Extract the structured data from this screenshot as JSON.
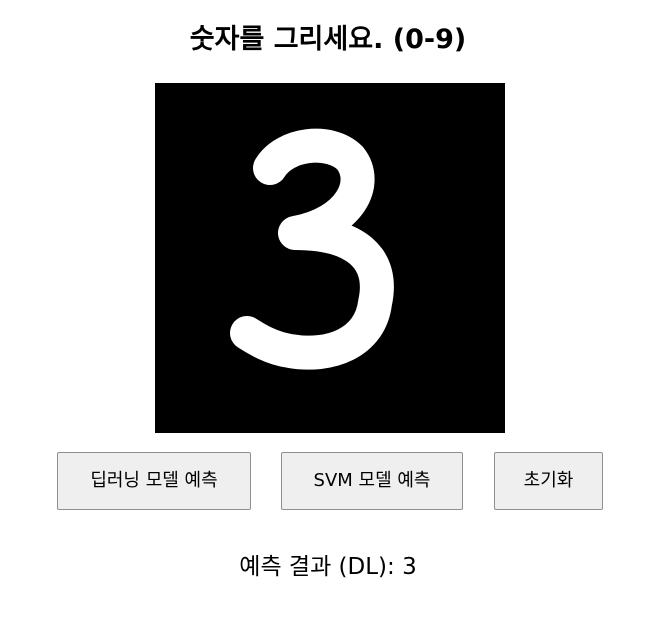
{
  "header": {
    "title": "숫자를 그리세요. (0-9)"
  },
  "canvas": {
    "background": "#000000",
    "stroke_color": "#ffffff",
    "drawn_digit": "3"
  },
  "buttons": {
    "dl_label": "딥러닝 모델 예측",
    "svm_label": "SVM 모델 예측",
    "reset_label": "초기화"
  },
  "result": {
    "text": "예측 결과 (DL): 3"
  }
}
